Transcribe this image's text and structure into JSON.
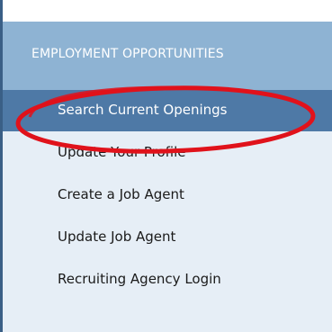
{
  "nav": {
    "header": "EMPLOYMENT OPPORTUNITIES",
    "items": [
      {
        "label": "Search Current Openings",
        "active": true
      },
      {
        "label": "Update Your Profile",
        "active": false
      },
      {
        "label": "Create a Job Agent",
        "active": false
      },
      {
        "label": "Update Job Agent",
        "active": false
      },
      {
        "label": "Recruiting Agency Login",
        "active": false
      }
    ]
  },
  "colors": {
    "header_bg": "#8eb3d3",
    "active_bg": "#4e79a6",
    "menu_bg": "#e6eef6",
    "annotation_circle": "#e0121b"
  }
}
